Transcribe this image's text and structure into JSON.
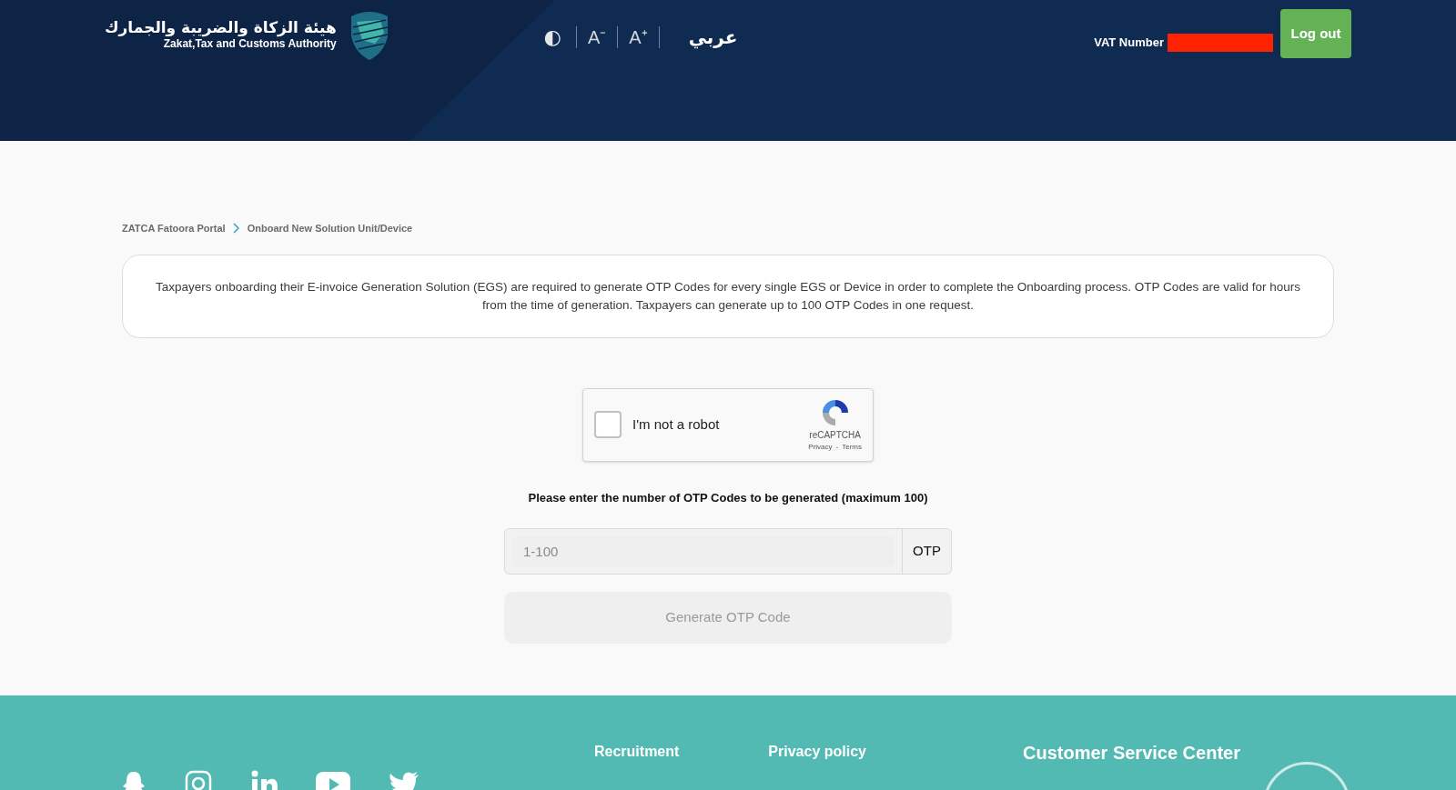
{
  "header": {
    "logo_arabic": "هيئة الزكاة والضريبة والجمارك",
    "logo_english": "Zakat,Tax and Customs Authority",
    "contrast_icon": "◐",
    "font_decrease": "A⁻",
    "font_increase": "A⁺",
    "language": "عربي",
    "vat_label": "VAT Number",
    "logout": "Log out"
  },
  "breadcrumb": [
    {
      "label": "ZATCA Fatoora Portal"
    },
    {
      "label": "Onboard New Solution Unit/Device"
    }
  ],
  "info": "Taxpayers onboarding their E-invoice Generation Solution (EGS) are required to generate OTP Codes for every single EGS or Device in order to complete the Onboarding process. OTP Codes are valid for hours from the time of generation. Taxpayers can generate up to 100 OTP Codes in one request.",
  "captcha": {
    "label": "I'm not a robot",
    "checked": false,
    "brand": "reCAPTCHA",
    "privacy": "Privacy",
    "separator": "-",
    "terms": "Terms"
  },
  "otp_prompt": "Please enter the number of OTP Codes to be generated (maximum 100)",
  "otp_field": {
    "placeholder": "1-100",
    "addon": "OTP"
  },
  "generate_button": {
    "label": "Generate OTP Code",
    "disabled": true
  },
  "footer": {
    "links": [
      "Recruitment",
      "Privacy policy"
    ],
    "customer_service": "Customer Service Center"
  }
}
